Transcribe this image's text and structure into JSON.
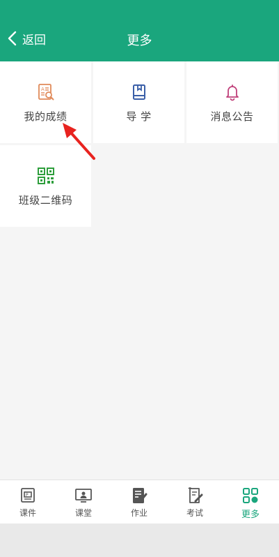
{
  "header": {
    "back_label": "返回",
    "title": "更多"
  },
  "tiles": [
    {
      "label": "我的成绩",
      "icon": "grade-report-icon",
      "color": "#e08a5a"
    },
    {
      "label": "导 学",
      "icon": "book-icon",
      "color": "#3a5fa8"
    },
    {
      "label": "消息公告",
      "icon": "bell-icon",
      "color": "#c0407a"
    },
    {
      "label": "班级二维码",
      "icon": "qr-code-icon",
      "color": "#2e9e3c"
    }
  ],
  "tabbar": {
    "items": [
      {
        "label": "课件",
        "icon": "courseware-icon"
      },
      {
        "label": "课堂",
        "icon": "classroom-icon"
      },
      {
        "label": "作业",
        "icon": "homework-icon"
      },
      {
        "label": "考试",
        "icon": "exam-icon"
      },
      {
        "label": "更多",
        "icon": "more-grid-icon",
        "active": true
      }
    ]
  },
  "colors": {
    "brand": "#1aa67d",
    "annotation_arrow": "#e8231f"
  }
}
